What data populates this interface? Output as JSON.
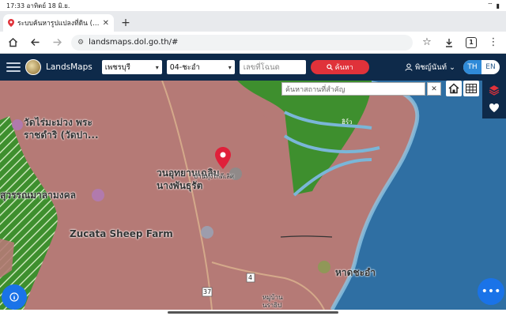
{
  "status": {
    "time": "17:33",
    "date": "อาทิตย์ 18 มิ.ย.",
    "battery": "▮"
  },
  "browser": {
    "tab_title": "ระบบค้นหารูปแปลงที่ดิน (LandsMaps)",
    "new_tab": "+",
    "url": "landsmaps.dol.go.th/#",
    "tabs_count": "1"
  },
  "app": {
    "brand": "LandsMaps",
    "province": "เพชรบุรี",
    "district": "04-ชะอำ",
    "parcel_placeholder": "เลขที่โฉนด",
    "search_label": "ค้นหา",
    "user_name": "พิชญ์นันท์",
    "lang_th": "TH",
    "lang_en": "EN",
    "place_search_placeholder": "ค้นหาสถานที่สำคัญ",
    "clear_label": "✕"
  },
  "map": {
    "labels": {
      "temple1_line1": "วัดไร่มะม่วง พระ",
      "temple1_line2": "ราชดำริ (วัดปา...",
      "temple2": "สุวรรณมาลามงคล",
      "place1_line1": "วนอุทยานเฉลิม",
      "place1_line2": "นางพันธุรัต",
      "place1_sub": "บ้านทุ่งไก่ดีเลิศ",
      "sheep_farm": "Zucata Sheep Farm",
      "beach": "หาดชะอำ",
      "village_line1": "หมู่บ้าน",
      "village_line2": "นราธิป",
      "road_number": "4",
      "road_shield": "37",
      "mangrove": "ฮิร์ว"
    }
  },
  "colors": {
    "navbar": "#0e2a4a",
    "search_red": "#e0323a",
    "parcel_pink": "#b57a76",
    "forest_green": "#3e8f2e",
    "sea_blue": "#2f6fa3",
    "accent_blue": "#1a73e8"
  }
}
